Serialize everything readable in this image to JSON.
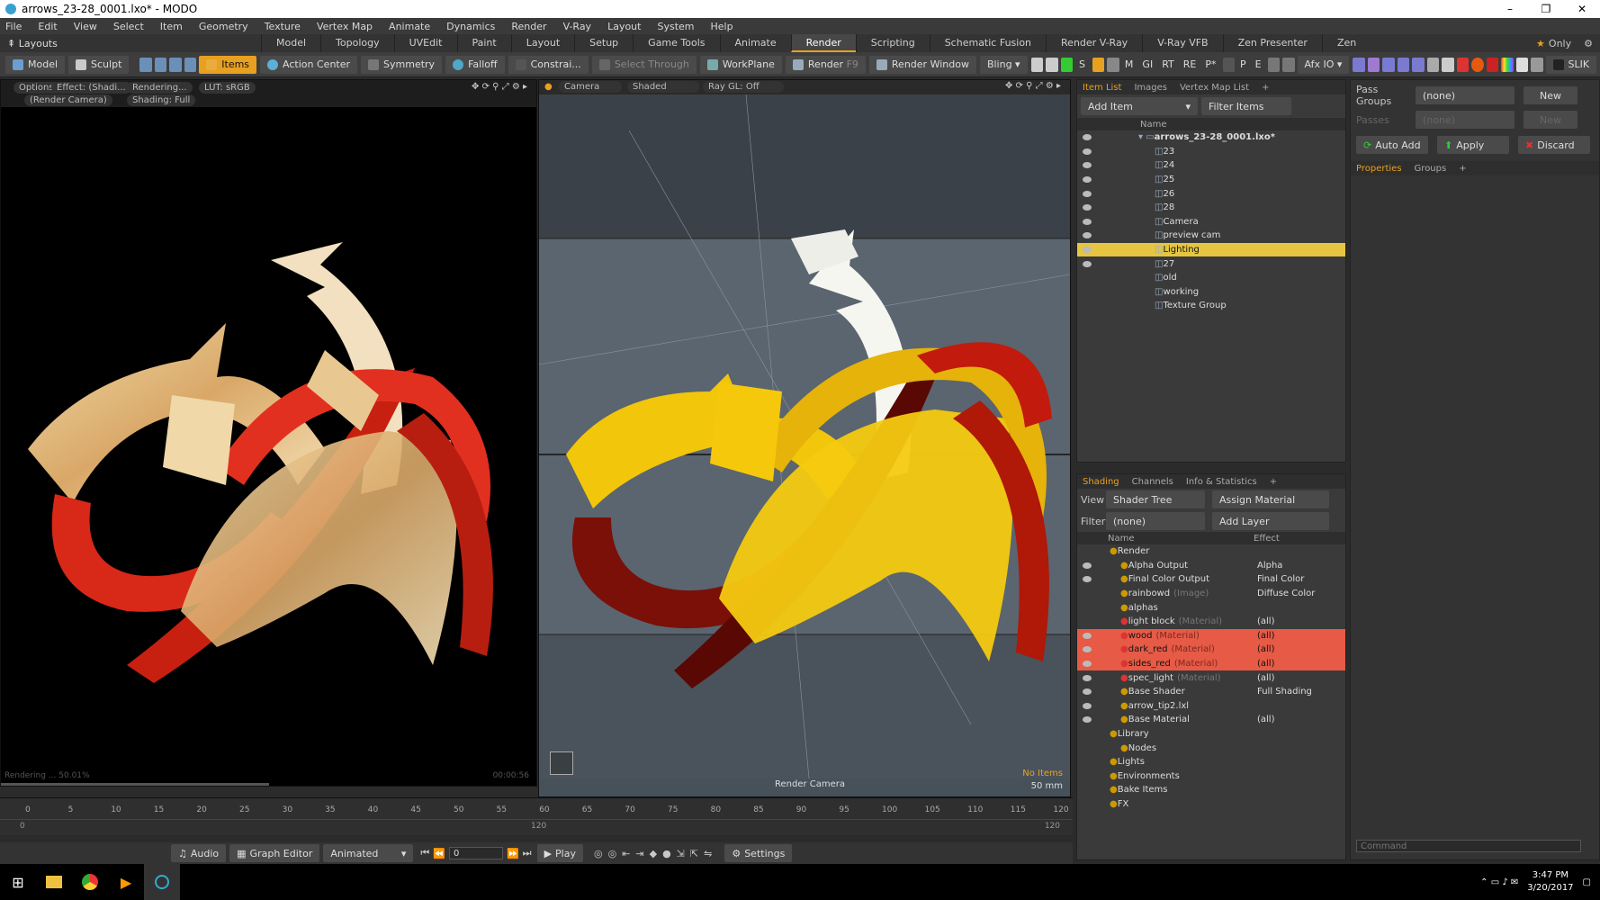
{
  "window": {
    "title": "arrows_23-28_0001.lxo* - MODO"
  },
  "menu": [
    "File",
    "Edit",
    "View",
    "Select",
    "Item",
    "Geometry",
    "Texture",
    "Vertex Map",
    "Animate",
    "Dynamics",
    "Render",
    "V-Ray",
    "Layout",
    "System",
    "Help"
  ],
  "layouts_label": "Layouts",
  "layout_tabs": [
    "Model",
    "Topology",
    "UVEdit",
    "Paint",
    "Layout",
    "Setup",
    "Game Tools",
    "Animate",
    "Render",
    "Scripting",
    "Schematic Fusion",
    "Render V-Ray",
    "V-Ray VFB",
    "Zen Presenter",
    "Zen"
  ],
  "active_layout_tab": "Render",
  "only_label": "Only",
  "toolbar": {
    "model": "Model",
    "sculpt": "Sculpt",
    "items": "Items",
    "action_center": "Action Center",
    "symmetry": "Symmetry",
    "falloff": "Falloff",
    "constraints": "Constrai...",
    "select_through": "Select Through",
    "workplane": "WorkPlane",
    "render": "Render",
    "render_shortcut": "F9",
    "render_window": "Render Window",
    "bling": "Bling",
    "s": "S",
    "m": "M",
    "gi": "GI",
    "rt": "RT",
    "re": "RE",
    "p_star": "P*",
    "p": "P",
    "e": "E",
    "afx": "Afx IO",
    "slik": "SLIK"
  },
  "left_viewport": {
    "options": "Options",
    "effect": "Effect: (Shadi...",
    "rendering": "Rendering...",
    "lut": "LUT: sRGB",
    "camera": "(Render Camera)",
    "shading": "Shading: Full",
    "progress_text": "Rendering ... 50.01%",
    "time": "00:00:56"
  },
  "mid_viewport": {
    "camera": "Camera",
    "shaded": "Shaded",
    "raygl": "Ray GL: Off",
    "render_camera_label": "Render Camera",
    "no_items": "No Items",
    "lens": "50 mm"
  },
  "item_list": {
    "tabs": [
      "Item List",
      "Images",
      "Vertex Map List"
    ],
    "add_item": "Add Item",
    "filter_items": "Filter Items",
    "name_header": "Name",
    "items": [
      {
        "label": "arrows_23-28_0001.lxo*",
        "indent": 0,
        "eye": true,
        "bold": true
      },
      {
        "label": "23",
        "indent": 1,
        "eye": true
      },
      {
        "label": "24",
        "indent": 1,
        "eye": true
      },
      {
        "label": "25",
        "indent": 1,
        "eye": true
      },
      {
        "label": "26",
        "indent": 1,
        "eye": true
      },
      {
        "label": "28",
        "indent": 1,
        "eye": true
      },
      {
        "label": "Camera",
        "indent": 1,
        "eye": true
      },
      {
        "label": "preview cam",
        "indent": 1,
        "eye": true
      },
      {
        "label": "Lighting",
        "indent": 1,
        "eye": true,
        "selected": true
      },
      {
        "label": "27",
        "indent": 1,
        "eye": true
      },
      {
        "label": "old",
        "indent": 1,
        "eye": false
      },
      {
        "label": "working",
        "indent": 1,
        "eye": false
      },
      {
        "label": "Texture Group",
        "indent": 1,
        "eye": false
      }
    ]
  },
  "shading": {
    "tabs": [
      "Shading",
      "Channels",
      "Info & Statistics"
    ],
    "view_label": "View",
    "view_value": "Shader Tree",
    "assign_material": "Assign Material",
    "filter_label": "Filter",
    "filter_value": "(none)",
    "add_layer": "Add Layer",
    "name_header": "Name",
    "effect_header": "Effect",
    "rows": [
      {
        "name": "Render",
        "type": "",
        "effect": "",
        "indent": 0,
        "eye": false
      },
      {
        "name": "Alpha Output",
        "type": "",
        "effect": "Alpha",
        "indent": 1,
        "eye": true
      },
      {
        "name": "Final Color Output",
        "type": "",
        "effect": "Final Color",
        "indent": 1,
        "eye": true
      },
      {
        "name": "rainbowd",
        "type": "(Image)",
        "effect": "Diffuse Color",
        "indent": 1,
        "eye": false
      },
      {
        "name": "alphas",
        "type": "",
        "effect": "",
        "indent": 1,
        "eye": false
      },
      {
        "name": "light block",
        "type": "(Material)",
        "effect": "(all)",
        "indent": 1,
        "eye": false
      },
      {
        "name": "wood",
        "type": "(Material)",
        "effect": "(all)",
        "indent": 1,
        "eye": true,
        "highlight": true
      },
      {
        "name": "dark_red",
        "type": "(Material)",
        "effect": "(all)",
        "indent": 1,
        "eye": true,
        "highlight": true
      },
      {
        "name": "sides_red",
        "type": "(Material)",
        "effect": "(all)",
        "indent": 1,
        "eye": true,
        "highlight": true
      },
      {
        "name": "spec_light",
        "type": "(Material)",
        "effect": "(all)",
        "indent": 1,
        "eye": true
      },
      {
        "name": "Base Shader",
        "type": "",
        "effect": "Full Shading",
        "indent": 1,
        "eye": true
      },
      {
        "name": "arrow_tip2.lxl",
        "type": "",
        "effect": "",
        "indent": 1,
        "eye": true
      },
      {
        "name": "Base Material",
        "type": "",
        "effect": "(all)",
        "indent": 1,
        "eye": true
      },
      {
        "name": "Library",
        "type": "",
        "effect": "",
        "indent": 0,
        "eye": false
      },
      {
        "name": "Nodes",
        "type": "",
        "effect": "",
        "indent": 1,
        "eye": false
      },
      {
        "name": "Lights",
        "type": "",
        "effect": "",
        "indent": 0,
        "eye": false
      },
      {
        "name": "Environments",
        "type": "",
        "effect": "",
        "indent": 0,
        "eye": false
      },
      {
        "name": "Bake Items",
        "type": "",
        "effect": "",
        "indent": 0,
        "eye": false
      },
      {
        "name": "FX",
        "type": "",
        "effect": "",
        "indent": 0,
        "eye": false
      }
    ]
  },
  "right_panel": {
    "pass_groups_label": "Pass Groups",
    "pass_groups_value": "(none)",
    "new_label": "New",
    "passes_label": "Passes",
    "passes_value": "(none)",
    "new2_label": "New",
    "auto_add": "Auto Add",
    "apply": "Apply",
    "discard": "Discard",
    "tabs": [
      "Properties",
      "Groups"
    ],
    "command_placeholder": "Command"
  },
  "timeline": {
    "ticks": [
      0,
      5,
      10,
      15,
      20,
      25,
      30,
      35,
      40,
      45,
      50,
      55,
      60,
      65,
      70,
      75,
      80,
      85,
      90,
      95,
      100,
      105,
      110,
      115,
      120
    ],
    "start": "0",
    "end": "120",
    "max_label": "120"
  },
  "transport": {
    "audio": "Audio",
    "graph_editor": "Graph Editor",
    "animated": "Animated",
    "frame": "0",
    "play": "Play",
    "settings": "Settings"
  },
  "taskbar": {
    "time": "3:47 PM",
    "date": "3/20/2017"
  },
  "colors": {
    "accent": "#e8a020",
    "selected_row": "#e6c640",
    "material_row": "#e65a46"
  }
}
